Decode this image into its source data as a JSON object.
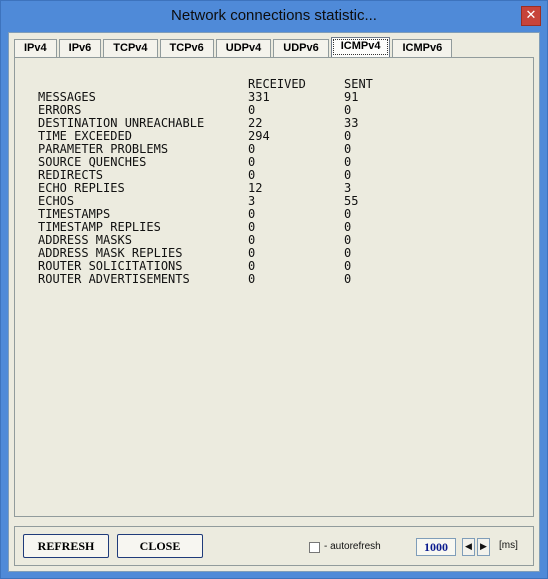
{
  "window": {
    "title": "Network connections statistic...",
    "close_glyph": "✕"
  },
  "tabs": [
    {
      "label": "IPv4",
      "active": false
    },
    {
      "label": "IPv6",
      "active": false
    },
    {
      "label": "TCPv4",
      "active": false
    },
    {
      "label": "TCPv6",
      "active": false
    },
    {
      "label": "UDPv4",
      "active": false
    },
    {
      "label": "UDPv6",
      "active": false
    },
    {
      "label": "ICMPv4",
      "active": true
    },
    {
      "label": "ICMPv6",
      "active": false
    }
  ],
  "stats": {
    "headers": [
      "",
      "RECEIVED",
      "SENT"
    ],
    "rows": [
      [
        "MESSAGES",
        "331",
        "91"
      ],
      [
        "ERRORS",
        "0",
        "0"
      ],
      [
        "DESTINATION UNREACHABLE",
        "22",
        "33"
      ],
      [
        "TIME EXCEEDED",
        "294",
        "0"
      ],
      [
        "PARAMETER PROBLEMS",
        "0",
        "0"
      ],
      [
        "SOURCE QUENCHES",
        "0",
        "0"
      ],
      [
        "REDIRECTS",
        "0",
        "0"
      ],
      [
        "ECHO REPLIES",
        "12",
        "3"
      ],
      [
        "ECHOS",
        "3",
        "55"
      ],
      [
        "TIMESTAMPS",
        "0",
        "0"
      ],
      [
        "TIMESTAMP REPLIES",
        "0",
        "0"
      ],
      [
        "ADDRESS MASKS",
        "0",
        "0"
      ],
      [
        "ADDRESS MASK REPLIES",
        "0",
        "0"
      ],
      [
        "ROUTER SOLICITATIONS",
        "0",
        "0"
      ],
      [
        "ROUTER ADVERTISEMENTS",
        "0",
        "0"
      ]
    ]
  },
  "footer": {
    "refresh_label": "REFRESH",
    "close_label": "CLOSE",
    "autorefresh_label": "- autorefresh",
    "autorefresh_checked": false,
    "interval_value": "1000",
    "spin_left_glyph": "◀",
    "spin_right_glyph": "▶",
    "interval_unit": "[ms]"
  }
}
